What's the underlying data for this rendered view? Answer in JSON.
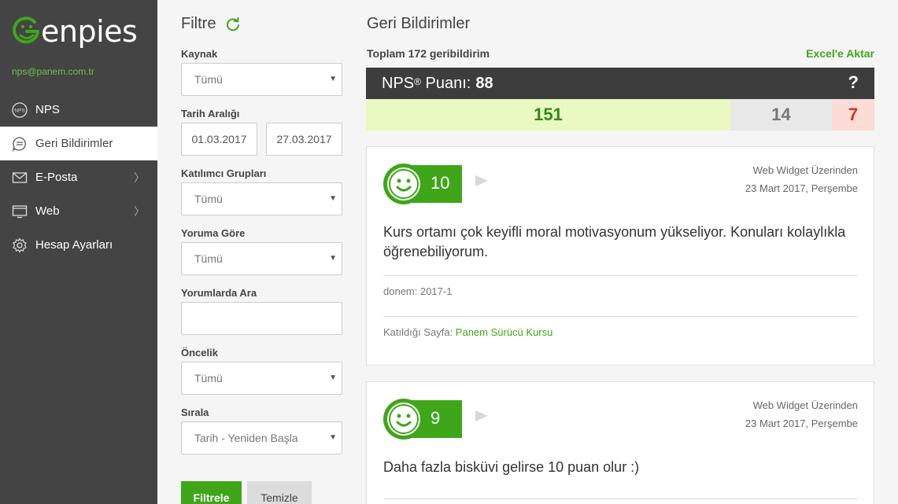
{
  "app": {
    "logo_text": "enpies",
    "user_email": "nps@panem.com.tr",
    "brand_color": "#3fa61a"
  },
  "sidebar": {
    "items": [
      {
        "label": "NPS",
        "icon": "nps-icon",
        "active": false,
        "has_submenu": false
      },
      {
        "label": "Geri Bildirimler",
        "icon": "chat-icon",
        "active": true,
        "has_submenu": false
      },
      {
        "label": "E-Posta",
        "icon": "envelope-icon",
        "active": false,
        "has_submenu": true,
        "chevron": "〉"
      },
      {
        "label": "Web",
        "icon": "web-window-icon",
        "active": false,
        "has_submenu": true,
        "chevron": "〉"
      },
      {
        "label": "Hesap Ayarları",
        "icon": "gear-icon",
        "active": false,
        "has_submenu": false
      }
    ]
  },
  "filter": {
    "title": "Filtre",
    "source_label": "Kaynak",
    "source_value": "Tümü",
    "date_label": "Tarih Aralığı",
    "date_from": "01.03.2017",
    "date_to": "27.03.2017",
    "groups_label": "Katılımcı Grupları",
    "groups_value": "Tümü",
    "comment_label": "Yoruma Göre",
    "comment_value": "Tümü",
    "search_label": "Yorumlarda Ara",
    "search_value": "",
    "priority_label": "Öncelik",
    "priority_value": "Tümü",
    "sort_label": "Sırala",
    "sort_value": "Tarih - Yeniden Başla",
    "filter_button": "Filtrele",
    "clear_button": "Temizle",
    "select_arrow": "▼"
  },
  "main": {
    "title": "Geri Bildirimler",
    "total": "Toplam 172 geribildirim",
    "export_label": "Excel'e Aktar",
    "nps_label": "NPS",
    "nps_sup": "®",
    "nps_label_suffix": "Puanı:",
    "nps_score": "88",
    "nps_help": "?",
    "promoters": "151",
    "passives": "14",
    "detractors": "7"
  },
  "feedback": [
    {
      "score": "10",
      "source": "Web Widget Üzerinden",
      "date": "23 Mart 2017, Perşembe",
      "text": "Kurs ortamı çok keyifli moral motivasyonum yükseliyor. Konuları kolaylıkla öğrenebiliyorum.",
      "meta": "donem: 2017-1",
      "page_label": "Katıldığı Sayfa:",
      "page_link": "Panem Sürücü Kursu"
    },
    {
      "score": "9",
      "source": "Web Widget Üzerinden",
      "date": "23 Mart 2017, Perşembe",
      "text": "Daha fazla bisküvi gelirse 10 puan olur :)"
    }
  ]
}
